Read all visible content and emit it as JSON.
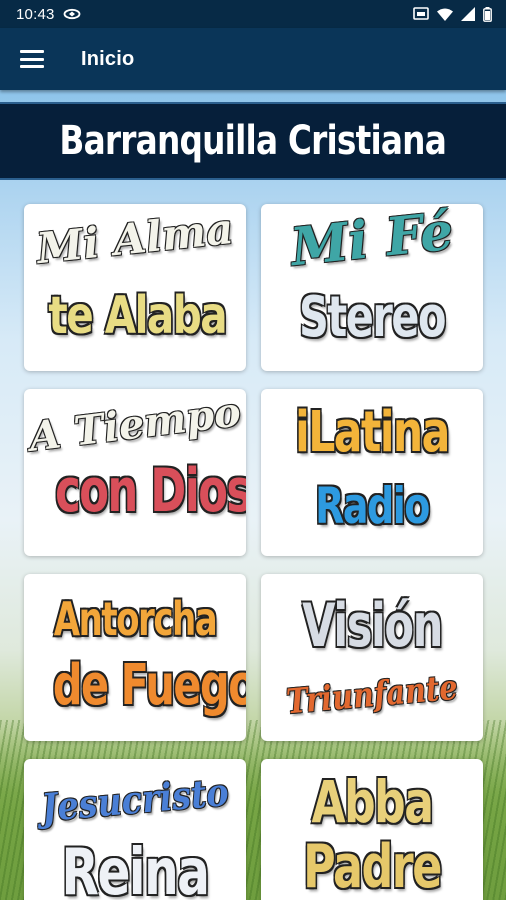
{
  "status_bar": {
    "time": "10:43"
  },
  "toolbar": {
    "title": "Inicio"
  },
  "banner": {
    "title": "Barranquilla Cristiana"
  },
  "stations": [
    {
      "line1": "Mi Alma",
      "line2": "te Alaba"
    },
    {
      "line1": "Mi Fé",
      "line2": "Stereo"
    },
    {
      "line1": "A Tiempo",
      "line2": "con Dios"
    },
    {
      "line1": "iLatina",
      "line2": "Radio"
    },
    {
      "line1": "Antorcha",
      "line2": "de Fuego"
    },
    {
      "line1": "Visión",
      "line2": "Triunfante"
    },
    {
      "line1": "Jesucristo",
      "line2": "Reina"
    },
    {
      "line1": "Abba",
      "line2": "Padre"
    }
  ],
  "colors": {
    "status_bar": "#072a46",
    "toolbar": "#0a3558",
    "banner": "#061f3a"
  }
}
